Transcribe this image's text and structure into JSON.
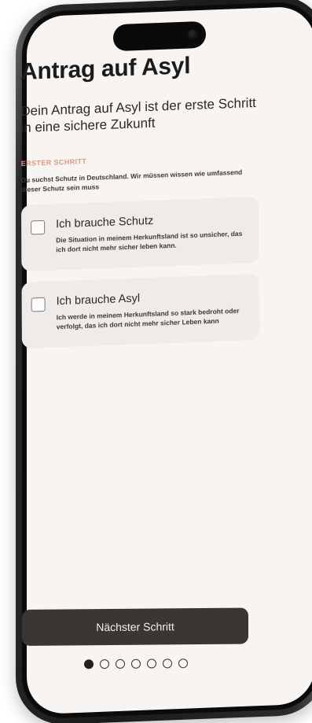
{
  "screen": {
    "title": "Antrag auf Asyl",
    "intro": "Dein Antrag auf Asyl ist der erste Schritt in eine sichere Zukunft",
    "step_label": "ERSTER SCHRITT",
    "step_description": "Du suchst Schutz in Deutschland. Wir müssen wissen wie umfassend dieser Schutz sein muss"
  },
  "options": [
    {
      "title": "Ich brauche Schutz",
      "description": "Die Situation in meinem Herkunftsland ist so unsicher, das ich dort nicht mehr sicher leben kann.",
      "checked": false
    },
    {
      "title": "Ich brauche Asyl",
      "description": "Ich werde in meinem Herkunftsland so stark bedroht oder verfolgt, das ich dort nicht mehr sicher Leben kann",
      "checked": false
    }
  ],
  "footer": {
    "next_label": "Nächster Schritt",
    "page_count": 7,
    "current_page": 1
  },
  "colors": {
    "screen_bg": "#f7f4f2",
    "card_bg": "#efebe9",
    "accent_label": "#d79a7e",
    "button_bg": "#3b3534"
  }
}
